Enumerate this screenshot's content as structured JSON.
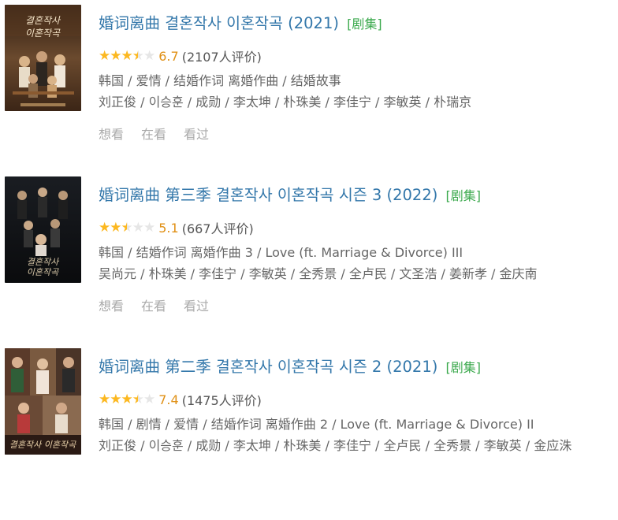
{
  "results": [
    {
      "title": "婚词离曲 결혼작사 이혼작곡 (2021)",
      "tag": "[剧集]",
      "rating": 3.5,
      "score": "6.7",
      "votes": "(2107人评价)",
      "meta1": "韩国 / 爱情 / 结婚作词 离婚作曲 / 结婚故事",
      "meta2": "刘正俊 / 이승훈 / 成勋 / 李太坤 / 朴珠美 / 李佳宁 / 李敏英 / 朴瑞京",
      "actions": [
        "想看",
        "在看",
        "看过"
      ],
      "poster": {
        "bg": "#4a3322",
        "accent": "#c9a06a"
      }
    },
    {
      "title": "婚词离曲 第三季 결혼작사 이혼작곡 시즌 3 (2022)",
      "tag": "[剧集]",
      "rating": 2.5,
      "score": "5.1",
      "votes": "(667人评价)",
      "meta1": "韩国 / 结婚作词 离婚作曲 3 / Love (ft. Marriage & Divorce) III",
      "meta2": "吴尚元 / 朴珠美 / 李佳宁 / 李敏英 / 全秀景 / 全卢民 / 文圣浩 / 姜新孝 / 金庆南",
      "actions": [
        "想看",
        "在看",
        "看过"
      ],
      "poster": {
        "bg": "#121418",
        "accent": "#8a7c66"
      }
    },
    {
      "title": "婚词离曲 第二季 결혼작사 이혼작곡 시즌 2 (2021)",
      "tag": "[剧集]",
      "rating": 3.5,
      "score": "7.4",
      "votes": "(1475人评价)",
      "meta1": "韩国 / 剧情 / 爱情 / 结婚作词 离婚作曲 2 / Love (ft. Marriage & Divorce) II",
      "meta2": "刘正俊 / 이승훈 / 成勋 / 李太坤 / 朴珠美 / 李佳宁 / 全卢民 / 全秀景 / 李敏英 / 金应洙",
      "actions": [
        "想看",
        "在看",
        "看过"
      ],
      "poster": {
        "bg": "#3a2a22",
        "accent": "#c8a87a"
      }
    }
  ],
  "colors": {
    "title": "#3377aa",
    "tag": "#3ba94d",
    "score": "#e09015",
    "star": "#fcb820"
  }
}
